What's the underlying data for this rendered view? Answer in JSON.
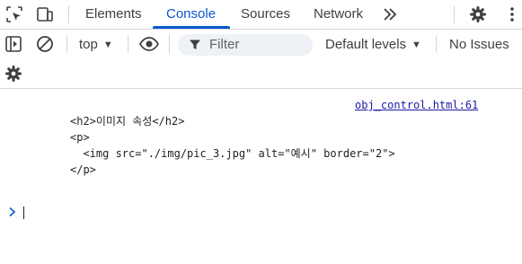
{
  "tabs": [
    {
      "label": "Elements",
      "active": false
    },
    {
      "label": "Console",
      "active": true
    },
    {
      "label": "Sources",
      "active": false
    },
    {
      "label": "Network",
      "active": false
    }
  ],
  "icons": {
    "inspect": "inspect-element-icon",
    "device": "device-toolbar-icon",
    "more_tabs": "chevron-double-right-icon",
    "settings": "gear-icon",
    "more_menu": "kebab-menu-icon",
    "sidebar": "sidebar-toggle-icon",
    "clear": "clear-console-icon",
    "eye": "live-expression-eye-icon",
    "filter": "filter-funnel-icon",
    "console_settings": "gear-icon",
    "prompt": "chevron-right-icon"
  },
  "toolbar": {
    "context": "top",
    "filter_placeholder": "Filter",
    "levels": "Default levels",
    "issues": "No Issues"
  },
  "console": {
    "source_link": "obj_control.html:61",
    "lines": [
      "<h2>이미지 속성</h2>",
      "<p>",
      "  <img src=\"./img/pic_3.jpg\" alt=\"예시\" border=\"2\">",
      "</p>"
    ]
  },
  "colors": {
    "accent": "#0b57d0",
    "link": "#1a1aa6",
    "border": "#d3d6da",
    "filter_bg": "#eef1f6"
  }
}
